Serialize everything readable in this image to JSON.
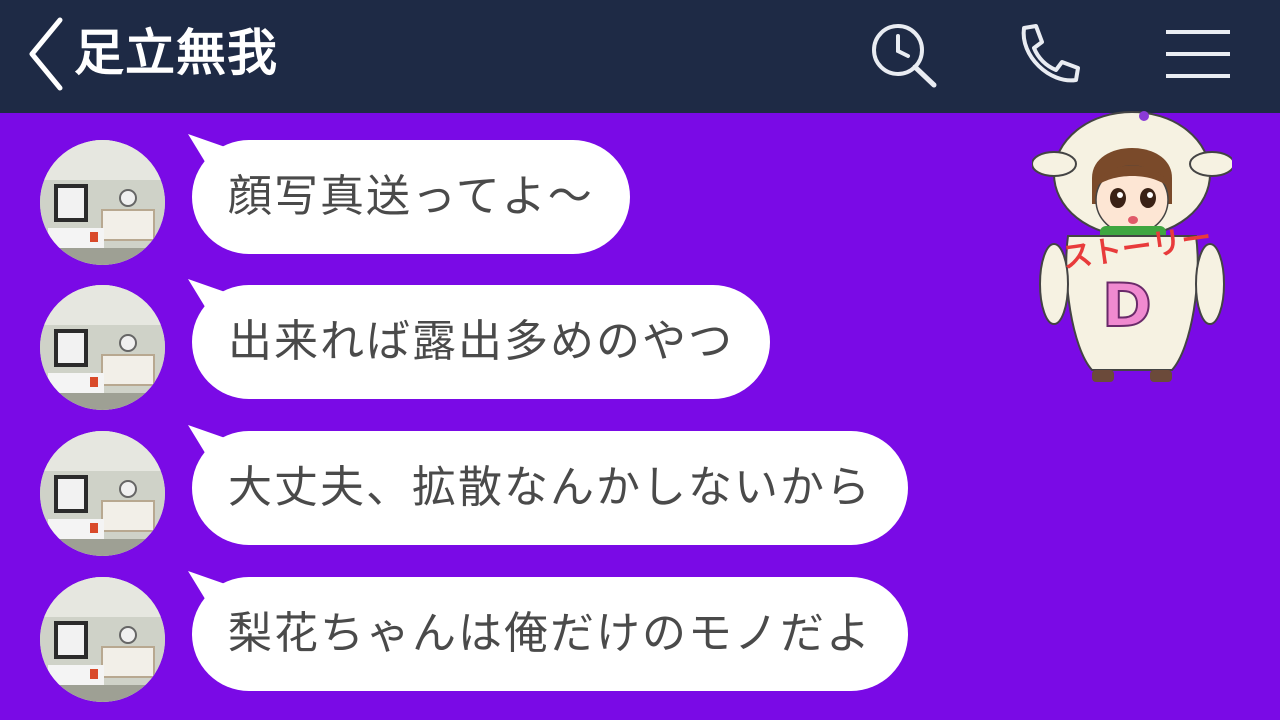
{
  "header": {
    "title": "足立無我",
    "icons": [
      "back-chevron-icon",
      "search-clock-icon",
      "phone-icon",
      "menu-icon"
    ],
    "background_color": "#1e2a45"
  },
  "chat": {
    "background_color": "#7a0ae6",
    "messages": [
      {
        "text": "顔写真送ってよ〜"
      },
      {
        "text": "出来れば露出多めのやつ"
      },
      {
        "text": "大丈夫、拡散なんかしないから"
      },
      {
        "text": "梨花ちゃんは俺だけのモノだよ"
      }
    ]
  },
  "sticker": {
    "label": "ストーリー",
    "letter": "D"
  }
}
